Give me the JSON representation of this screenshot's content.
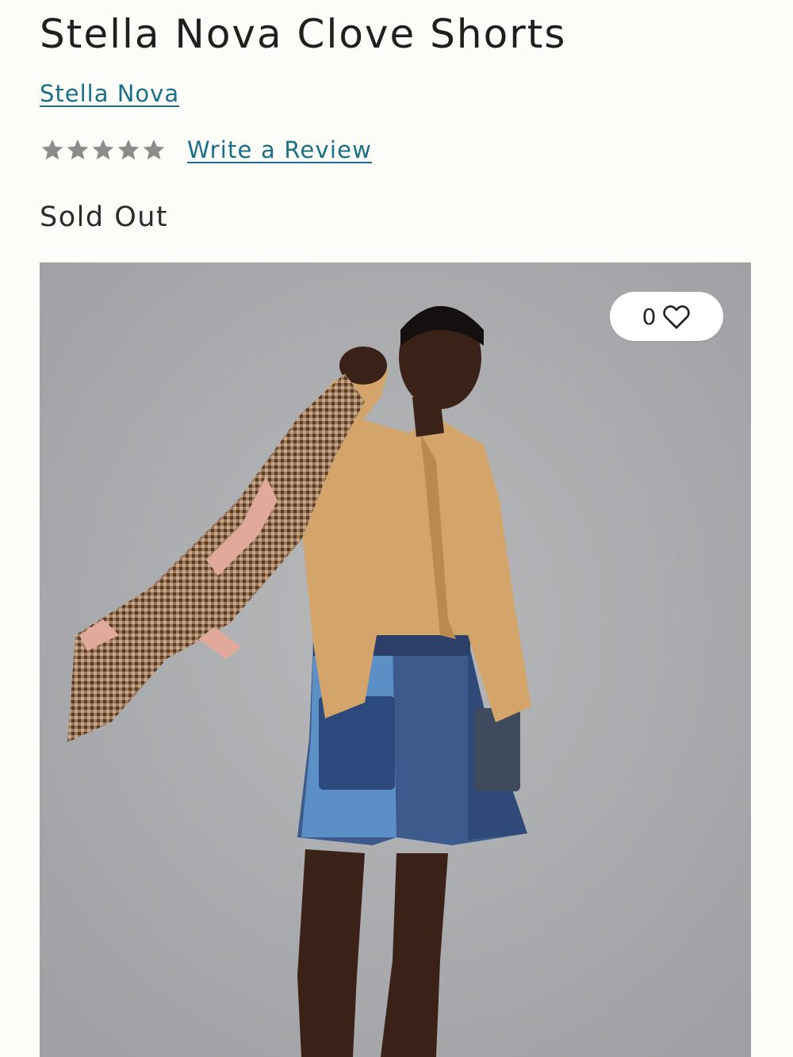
{
  "product": {
    "title": "Stella Nova Clove Shorts",
    "brand": "Stella Nova",
    "status": "Sold Out"
  },
  "rating": {
    "stars_filled": 0,
    "stars_total": 5,
    "star_color": "#8c8c8c",
    "review_link_label": "Write a Review"
  },
  "favorites": {
    "count": "0",
    "icon": "heart-outline-icon"
  },
  "image": {
    "description_icon": "product-photo"
  },
  "colors": {
    "link": "#1b6f86",
    "text": "#1f1f1f",
    "background": "#fcfcf9"
  }
}
